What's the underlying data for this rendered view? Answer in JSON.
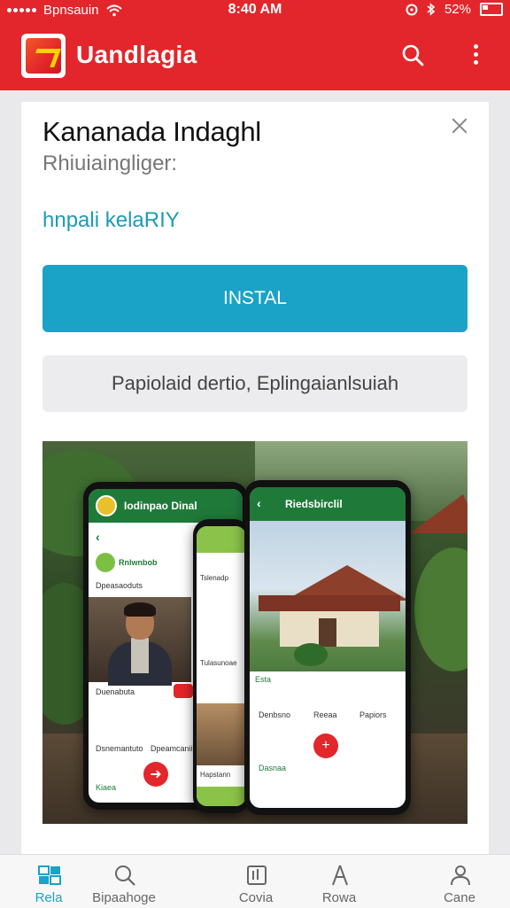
{
  "status_bar": {
    "carrier": "Bpnsauin",
    "time": "8:40 AM",
    "battery": "52%"
  },
  "app_bar": {
    "title": "Uandlagia",
    "logo_icon": "app-logo-icon",
    "search_icon": "search-icon",
    "more_icon": "more-vertical-icon"
  },
  "card": {
    "title": "Kananada Indaghl",
    "subtitle": "Rhiuiaingliger:",
    "link": "hnpali kelaRIY",
    "install_label": "INSTAL",
    "secondary_label": "Papiolaid dertio, Eplingaianlsuiah"
  },
  "promo": {
    "phone_left": {
      "app_name": "Iodinpao Dinal",
      "section_title": "Rnlwnbob",
      "section_sub": "Dpeasaoduts",
      "caption": "Duenabuta",
      "item1": "Dsnemantuto",
      "item2": "Dpeamcaniip",
      "nav_label": "Kiaea"
    },
    "phone_mid": {
      "item1": "Tslenadp",
      "item2": "Tulasunoae",
      "item3": "Hapstann"
    },
    "phone_right": {
      "app_name": "Riedsbirclil",
      "caption": "Esta",
      "action1": "Denbsno",
      "action2": "Reeaa",
      "action3": "Papiors",
      "nav_label": "Dasnaa"
    }
  },
  "bottom_nav": {
    "items": [
      {
        "label": "Rela",
        "icon": "grid-icon",
        "active": true
      },
      {
        "label": "Bipaahoge",
        "icon": "search-icon",
        "active": false
      },
      {
        "label": "Covia",
        "icon": "book-icon",
        "active": false
      },
      {
        "label": "Rowa",
        "icon": "compass-icon",
        "active": false
      },
      {
        "label": "Cane",
        "icon": "profile-icon",
        "active": false
      }
    ]
  },
  "colors": {
    "brand_red": "#e3262b",
    "accent_teal": "#1aa3c7",
    "link_teal": "#1b9bb8"
  }
}
